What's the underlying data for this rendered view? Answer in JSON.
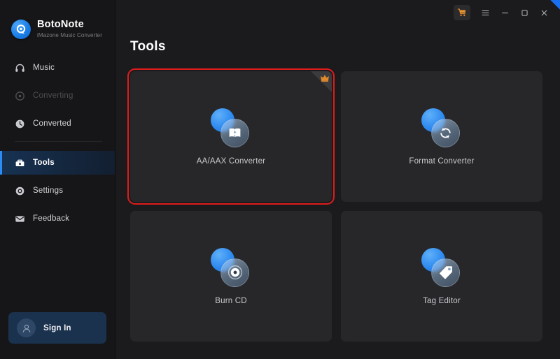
{
  "app": {
    "brand_name": "BotoNote",
    "brand_subtitle": "iMazone Music Converter",
    "logo_icon": "botonote-logo-icon",
    "accent_blue": "#2b8cf5",
    "accent_orange": "#e08a2c",
    "selection_red": "#e01b1b"
  },
  "titlebar": {
    "cart_icon": "shopping-cart-icon",
    "menu_icon": "hamburger-menu-icon",
    "minimize_icon": "minimize-icon",
    "maximize_icon": "maximize-icon",
    "close_icon": "close-icon"
  },
  "sidebar": {
    "items": [
      {
        "label": "Music",
        "icon": "headphones-icon",
        "state": "normal"
      },
      {
        "label": "Converting",
        "icon": "converting-icon",
        "state": "disabled"
      },
      {
        "label": "Converted",
        "icon": "clock-icon",
        "state": "normal"
      },
      {
        "label": "Tools",
        "icon": "toolbox-icon",
        "state": "active"
      },
      {
        "label": "Settings",
        "icon": "gear-icon",
        "state": "normal"
      },
      {
        "label": "Feedback",
        "icon": "envelope-icon",
        "state": "normal"
      }
    ],
    "signin": {
      "label": "Sign In",
      "avatar_icon": "user-avatar-icon"
    }
  },
  "main": {
    "page_title": "Tools",
    "cards": [
      {
        "label": "AA/AAX Converter",
        "icon": "audiobook-play-icon",
        "selected": true,
        "badge": "premium-crown-badge"
      },
      {
        "label": "Format Converter",
        "icon": "refresh-sync-icon",
        "selected": false,
        "badge": null
      },
      {
        "label": "Burn CD",
        "icon": "compact-disc-icon",
        "selected": false,
        "badge": null
      },
      {
        "label": "Tag Editor",
        "icon": "price-tag-icon",
        "selected": false,
        "badge": null
      }
    ]
  }
}
